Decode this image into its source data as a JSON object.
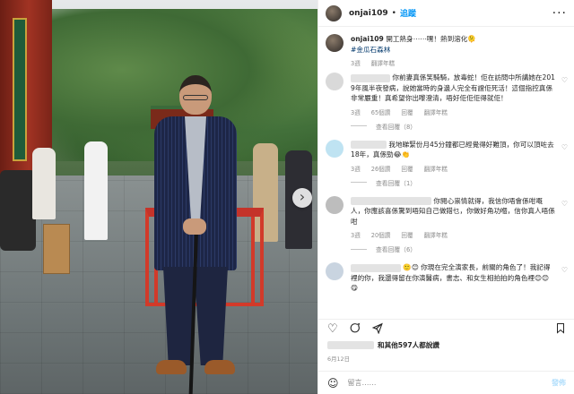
{
  "post": {
    "username": "onjai109",
    "separator": "•",
    "follow_label": "追蹤"
  },
  "caption": {
    "username": "onjai109",
    "text": "開工熱身⋯⋯嘿！熱到溶化🫠",
    "hashtag": "#金瓜石森林",
    "time": "3週",
    "translate_label": "翻譯年糕"
  },
  "comments": [
    {
      "text": "你前妻真係笑騎騎，放毒蛇！佢在訪問中所講她在2019年風半夜發病，說她當時的身邊人完全有證佢死活！這個指控真係非常嚴重！真希望你出嚟澄清，唔好佢佢佢得就佢！",
      "time": "3週",
      "likes": "65個讚",
      "reply_label": "回覆",
      "translate_label": "翻譯年糕",
      "replies_label": "查看回覆（8）",
      "avatar_color": "#d9d9d9"
    },
    {
      "text": "我地睇緊份月45分鐘都已經覺得好難頂，你可以頂咗去18年，真係勁😂👏",
      "time": "3週",
      "likes": "26個讚",
      "reply_label": "回覆",
      "translate_label": "翻譯年糕",
      "replies_label": "查看回覆（1）",
      "avatar_color": "#bfe3f2"
    },
    {
      "text": "你閱心祟情就得，我信你唔會係咁嘅人，你應該喜係驚到唔知自己做錯乜，你做好角功嗰，信你真人唔係咁",
      "time": "3週",
      "likes": "20個讚",
      "reply_label": "回覆",
      "translate_label": "翻譯年糕",
      "replies_label": "查看回覆（6）",
      "avatar_color": "#bdbdbd"
    },
    {
      "text": "🙂😊 你現在完全演家長，前關的角色了！我記得裡的你，我還得留在你演醫病，書志、和女生相拍拍的角色裡😊😊😋",
      "time": "",
      "likes": "",
      "reply_label": "",
      "translate_label": "",
      "replies_label": "",
      "avatar_color": "#c9d4e0"
    }
  ],
  "actions": {
    "like_icon": "heart-icon",
    "comment_icon": "comment-icon",
    "share_icon": "paper-plane-icon",
    "save_icon": "bookmark-icon"
  },
  "likes": {
    "text": "和其他597人都說讚"
  },
  "date": "6月12日",
  "composer": {
    "placeholder": "留言……",
    "post_label": "發佈"
  }
}
